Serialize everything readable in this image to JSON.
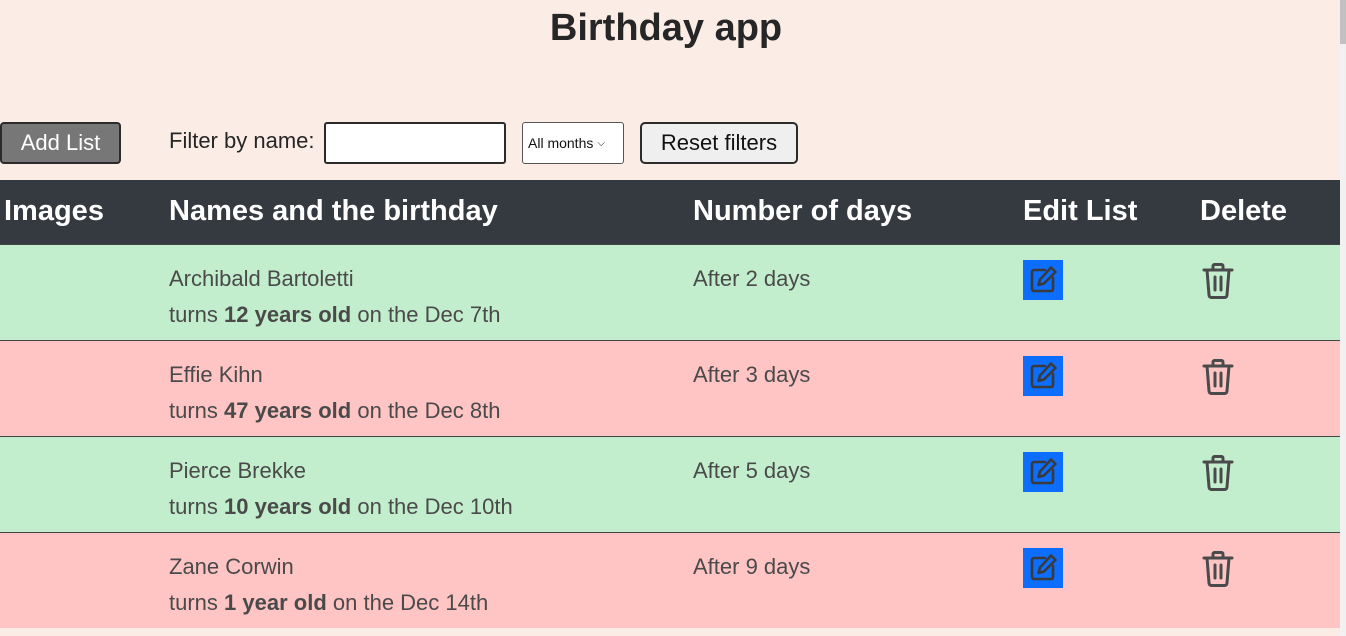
{
  "app": {
    "title": "Birthday app"
  },
  "toolbar": {
    "add_label": "Add List",
    "filter_label": "Filter by name:",
    "filter_value": "",
    "filter_placeholder": "",
    "month_selected": "All months",
    "reset_label": "Reset filters"
  },
  "table": {
    "headers": [
      "Images",
      "Names and the birthday",
      "Number of days",
      "Edit List",
      "Delete"
    ],
    "rows": [
      {
        "name": "Archibald Bartoletti",
        "turns": "turns",
        "age": "12 years old",
        "on": "on the Dec 7th",
        "days": "After 2 days",
        "color": "green"
      },
      {
        "name": "Effie Kihn",
        "turns": "turns",
        "age": "47 years old",
        "on": "on the Dec 8th",
        "days": "After 3 days",
        "color": "red"
      },
      {
        "name": "Pierce Brekke",
        "turns": "turns",
        "age": "10 years old",
        "on": "on the Dec 10th",
        "days": "After 5 days",
        "color": "green"
      },
      {
        "name": "Zane Corwin",
        "turns": "turns",
        "age": "1 year old",
        "on": "on the Dec 14th",
        "days": "After 9 days",
        "color": "red"
      }
    ]
  },
  "colors": {
    "page_bg": "#fbede6",
    "header_bg": "#343a40",
    "row_green": "#c3eecd",
    "row_red": "#ffc4c4",
    "edit_bg": "#0d6efd"
  },
  "icons": {
    "edit": "edit-icon",
    "delete": "trash-icon"
  }
}
